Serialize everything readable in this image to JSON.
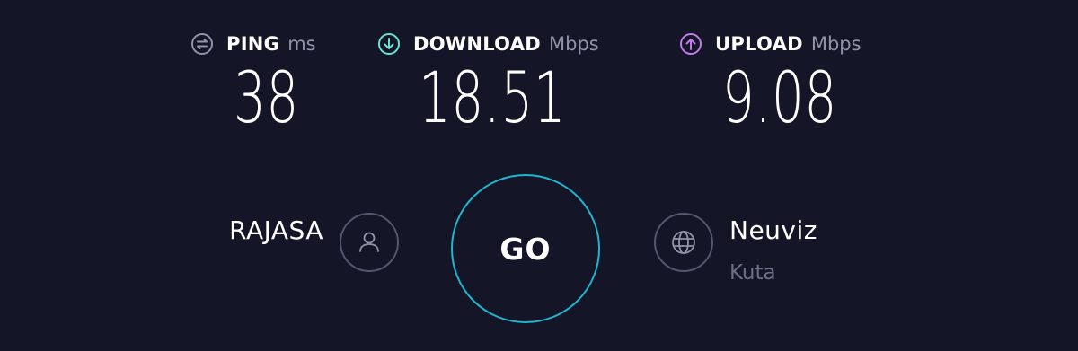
{
  "metrics": {
    "ping": {
      "label": "PING",
      "unit": "ms",
      "value": "38",
      "icon": "ping-icon",
      "color": "#9193a8"
    },
    "download": {
      "label": "DOWNLOAD",
      "unit": "Mbps",
      "value": "18.51",
      "icon": "download-arrow-icon",
      "color": "#6ee3d1"
    },
    "upload": {
      "label": "UPLOAD",
      "unit": "Mbps",
      "value": "9.08",
      "icon": "upload-arrow-icon",
      "color": "#c07ce8"
    }
  },
  "go_button": {
    "label": "GO",
    "ring_color": "#1fb7cf"
  },
  "isp": {
    "name": "RAJASA",
    "icon": "user-icon"
  },
  "server": {
    "name": "Neuviz",
    "location": "Kuta",
    "icon": "globe-icon"
  },
  "colors": {
    "background": "#141527",
    "text": "#ffffff",
    "muted": "#9193a8"
  }
}
